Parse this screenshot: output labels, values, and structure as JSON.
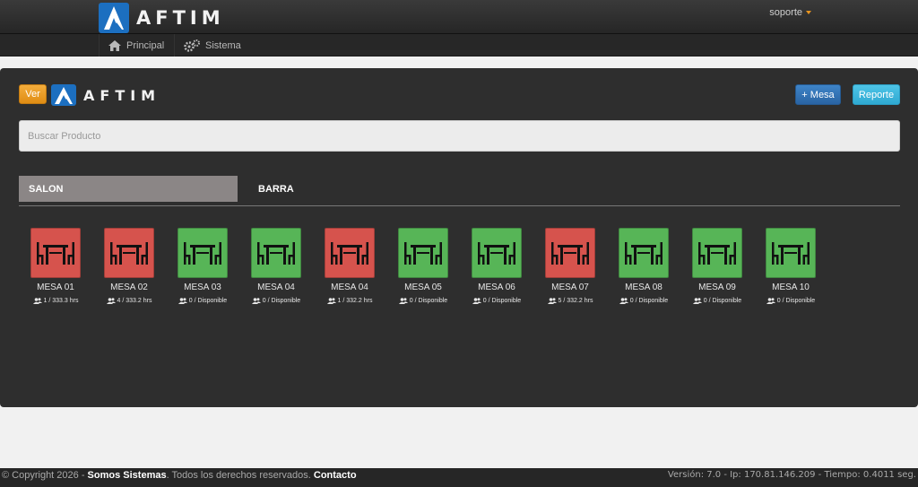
{
  "header": {
    "brand": "AFTIM",
    "user": "soporte"
  },
  "subnav": {
    "items": [
      {
        "label": "Principal",
        "icon": "home-icon"
      },
      {
        "label": "Sistema",
        "icon": "gears-icon"
      }
    ]
  },
  "toolbar": {
    "ver_label": "Ver",
    "brand": "AFTIM",
    "mesa_label": "+ Mesa",
    "reporte_label": "Reporte"
  },
  "search": {
    "placeholder": "Buscar Producto"
  },
  "tabs": [
    {
      "label": "SALON",
      "active": true
    },
    {
      "label": "BARRA",
      "active": false
    }
  ],
  "colors": {
    "occupied": "#d6534d",
    "available": "#57b557",
    "accent": "#e08d14"
  },
  "mesas": [
    {
      "name": "MESA 01",
      "info": "1 / 333.3 hrs",
      "status": "occupied"
    },
    {
      "name": "MESA 02",
      "info": "4 / 333.2 hrs",
      "status": "occupied"
    },
    {
      "name": "MESA 03",
      "info": "0 / Disponible",
      "status": "available"
    },
    {
      "name": "MESA 04",
      "info": "0 / Disponible",
      "status": "available"
    },
    {
      "name": "MESA 04",
      "info": "1 / 332.2 hrs",
      "status": "occupied"
    },
    {
      "name": "MESA 05",
      "info": "0 / Disponible",
      "status": "available"
    },
    {
      "name": "MESA 06",
      "info": "0 / Disponible",
      "status": "available"
    },
    {
      "name": "MESA 07",
      "info": "5 / 332.2 hrs",
      "status": "occupied"
    },
    {
      "name": "MESA 08",
      "info": "0 / Disponible",
      "status": "available"
    },
    {
      "name": "MESA 09",
      "info": "0 / Disponible",
      "status": "available"
    },
    {
      "name": "MESA 10",
      "info": "0 / Disponible",
      "status": "available"
    }
  ],
  "footer": {
    "copyright": "© Copyright 2026 - ",
    "company": "Somos Sistemas",
    "rights": ". Todos los derechos reservados. ",
    "contact": "Contacto",
    "meta": "Versión: 7.0 - Ip: 170.81.146.209 - Tiempo: 0.4011 seg."
  }
}
